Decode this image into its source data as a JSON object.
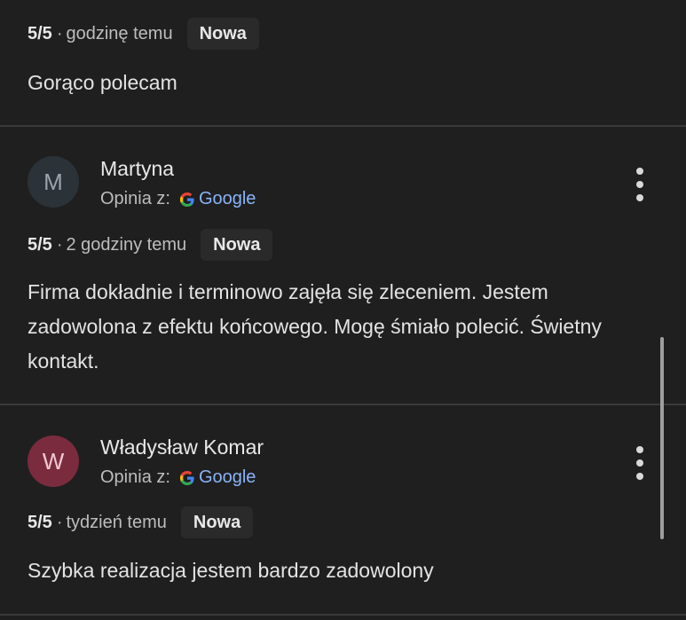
{
  "reviews": [
    {
      "score": "5/5",
      "separator": "·",
      "time": "godzinę temu",
      "badge": "Nowa",
      "text": "Gorąco polecam"
    },
    {
      "author": "Martyna",
      "avatar_letter": "M",
      "avatar_color": "#2b3238",
      "avatar_text_color": "#9aa4ad",
      "source_label": "Opinia z:",
      "source_name": "Google",
      "score": "5/5",
      "separator": "·",
      "time": "2 godziny temu",
      "badge": "Nowa",
      "text": "Firma dokładnie i terminowo zajęła się zleceniem. Jestem zadowolona z efektu końcowego. Mogę śmiało polecić. Świetny kontakt."
    },
    {
      "author": "Władysław Komar",
      "avatar_letter": "W",
      "avatar_color": "#7a2b3e",
      "avatar_text_color": "#f1c7d1",
      "source_label": "Opinia z:",
      "source_name": "Google",
      "score": "5/5",
      "separator": "·",
      "time": "tydzień temu",
      "badge": "Nowa",
      "text": "Szybka realizacja jestem bardzo zadowolony"
    }
  ],
  "icons": {
    "google": "google-g-icon",
    "more": "more-vertical-icon"
  },
  "colors": {
    "background": "#1f1f1f",
    "divider": "#3a3a3a",
    "link": "#8ab4f8"
  }
}
